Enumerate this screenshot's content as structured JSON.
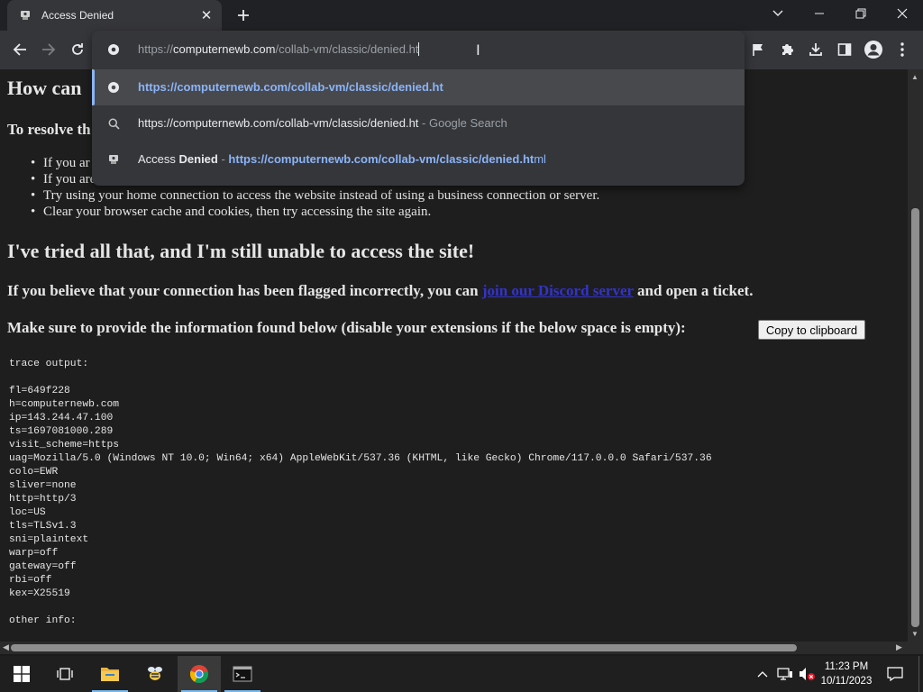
{
  "browser": {
    "tab": {
      "title": "Access Denied",
      "close": "✕"
    },
    "omnibox": {
      "input_scheme": "https://",
      "input_host": "computernewb.com",
      "input_path": "/collab-vm/classic/denied.ht",
      "suggestions": [
        {
          "text": "https://computernewb.com/collab-vm/classic/denied.ht"
        },
        {
          "text": "https://computernewb.com/collab-vm/classic/denied.ht",
          "desc": " - Google Search"
        },
        {
          "title_plain": "Access ",
          "title_bold": "Denied",
          "sep": " - ",
          "url_bold": "https://computernewb.com/collab-vm/classic/denied.ht",
          "url_rest": "ml"
        }
      ]
    }
  },
  "page": {
    "heading_partial": "How can",
    "resolve_partial": "To resolve th",
    "bullets": [
      "If you ar",
      "If you are",
      "Try using your home connection to access the website instead of using a business connection or server.",
      "Clear your browser cache and cookies, then try accessing the site again."
    ],
    "heading2": "I've tried all that, and I'm still unable to access the site!",
    "flag_text_before": "If you believe that your connection has been flagged incorrectly, you can ",
    "flag_link": "join our Discord server",
    "flag_text_after": " and open a ticket.",
    "provide_text": "Make sure to provide the information found below (disable your extensions if the below space is empty):",
    "copy_button": "Copy to clipboard",
    "trace_output": "trace output:\n\nfl=649f228\nh=computernewb.com\nip=143.244.47.100\nts=1697081000.289\nvisit_scheme=https\nuag=Mozilla/5.0 (Windows NT 10.0; Win64; x64) AppleWebKit/537.36 (KHTML, like Gecko) Chrome/117.0.0.0 Safari/537.36\ncolo=EWR\nsliver=none\nhttp=http/3\nloc=US\ntls=TLSv1.3\nsni=plaintext\nwarp=off\ngateway=off\nrbi=off\nkex=X25519\n\nother info:"
  },
  "taskbar": {
    "time": "11:23 PM",
    "date": "10/11/2023"
  },
  "colors": {
    "accent_link": "#8ab4f8",
    "page_link": "#3333cc",
    "page_bg": "#1e1e1e"
  }
}
